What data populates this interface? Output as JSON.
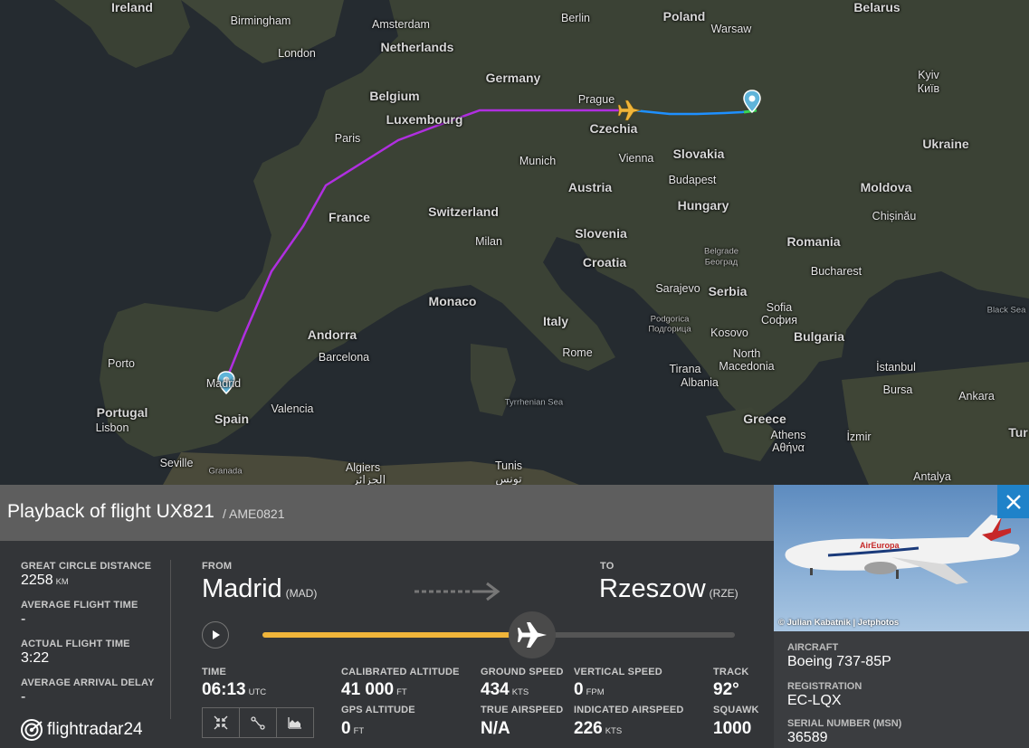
{
  "map": {
    "labels": {
      "ireland": "Ireland",
      "birmingham": "Birmingham",
      "london": "London",
      "amsterdam": "Amsterdam",
      "netherlands": "Netherlands",
      "berlin": "Berlin",
      "poland": "Poland",
      "warsaw": "Warsaw",
      "belarus": "Belarus",
      "germany": "Germany",
      "belgium": "Belgium",
      "luxembourg": "Luxembourg",
      "prague": "Prague",
      "czechia": "Czechia",
      "kyiv": "Kyiv",
      "kyiv_cyr": "Київ",
      "paris": "Paris",
      "ukraine": "Ukraine",
      "munich": "Munich",
      "vienna": "Vienna",
      "slovakia": "Slovakia",
      "budapest": "Budapest",
      "austria": "Austria",
      "moldova": "Moldova",
      "france": "France",
      "switzerland": "Switzerland",
      "hungary": "Hungary",
      "chisinau": "Chișinău",
      "milan": "Milan",
      "slovenia": "Slovenia",
      "romania": "Romania",
      "belgrade": "Belgrade",
      "belgrade_cyr": "Београд",
      "croatia": "Croatia",
      "bucharest": "Bucharest",
      "monaco": "Monaco",
      "sarajevo": "Sarajevo",
      "serbia": "Serbia",
      "sofia": "Sofia",
      "sofia_cyr": "София",
      "black_sea": "Black Sea",
      "italy": "Italy",
      "podgorica": "Podgorica",
      "podgorica_cyr": "Подгорица",
      "kosovo": "Kosovo",
      "bulgaria": "Bulgaria",
      "andorra": "Andorra",
      "porto": "Porto",
      "barcelona": "Barcelona",
      "rome": "Rome",
      "north": "North",
      "tirana": "Tirana",
      "macedonia": "Macedonia",
      "istanbul": "İstanbul",
      "madrid": "Madrid",
      "albania": "Albania",
      "bursa": "Bursa",
      "ankara": "Ankara",
      "portugal": "Portugal",
      "valencia": "Valencia",
      "tyrrhenian": "Tyrrhenian Sea",
      "lisbon": "Lisbon",
      "spain": "Spain",
      "greece": "Greece",
      "athens": "Athens",
      "athens_gr": "Αθήνα",
      "izmir": "İzmir",
      "turkey_partial": "Tur",
      "seville": "Seville",
      "granada": "Granada",
      "algiers": "Algiers",
      "algiers_ar": "الجزائر",
      "tunis": "Tunis",
      "tunis_ar": "تونس",
      "antalya": "Antalya"
    }
  },
  "panel": {
    "title": "Playback of flight UX821",
    "callsign": "/ AME0821",
    "great_circle_label": "GREAT CIRCLE DISTANCE",
    "great_circle_value": "2258",
    "great_circle_unit": "KM",
    "avg_flight_time_label": "AVERAGE FLIGHT TIME",
    "avg_flight_time_value": "-",
    "actual_flight_time_label": "ACTUAL FLIGHT TIME",
    "actual_flight_time_value": "3:22",
    "avg_arrival_delay_label": "AVERAGE ARRIVAL DELAY",
    "avg_arrival_delay_value": "-",
    "from_label": "FROM",
    "from_city": "Madrid",
    "from_code": "(MAD)",
    "to_label": "TO",
    "to_city": "Rzeszow",
    "to_code": "(RZE)",
    "progress": 0.57,
    "time_label": "TIME",
    "time_value": "06:13",
    "time_unit": "UTC",
    "cal_alt_label": "CALIBRATED ALTITUDE",
    "cal_alt_value": "41 000",
    "cal_alt_unit": "FT",
    "gps_alt_label": "GPS ALTITUDE",
    "gps_alt_value": "0",
    "gps_alt_unit": "FT",
    "ground_speed_label": "GROUND SPEED",
    "ground_speed_value": "434",
    "ground_speed_unit": "KTS",
    "true_airspeed_label": "TRUE AIRSPEED",
    "true_airspeed_value": "N/A",
    "vertical_speed_label": "VERTICAL SPEED",
    "vertical_speed_value": "0",
    "vertical_speed_unit": "FPM",
    "indicated_airspeed_label": "INDICATED AIRSPEED",
    "indicated_airspeed_value": "226",
    "indicated_airspeed_unit": "KTS",
    "track_label": "TRACK",
    "track_value": "92°",
    "squawk_label": "SQUAWK",
    "squawk_value": "1000",
    "logo_text": "flightradar24"
  },
  "side": {
    "photo_credit": "© Julian Kabatnik | Jetphotos",
    "aircraft_label": "AIRCRAFT",
    "aircraft_value": "Boeing 737-85P",
    "registration_label": "REGISTRATION",
    "registration_value": "EC-LQX",
    "serial_label": "SERIAL NUMBER (MSN)",
    "serial_value": "36589",
    "livery_text": "AirEuropa"
  },
  "colors": {
    "route_main": "#b02fe0",
    "route_end": "#1e90ff",
    "progress": "#f0b53a",
    "close_bg": "#1f82c9",
    "aircraft_icon": "#f0b53a"
  }
}
